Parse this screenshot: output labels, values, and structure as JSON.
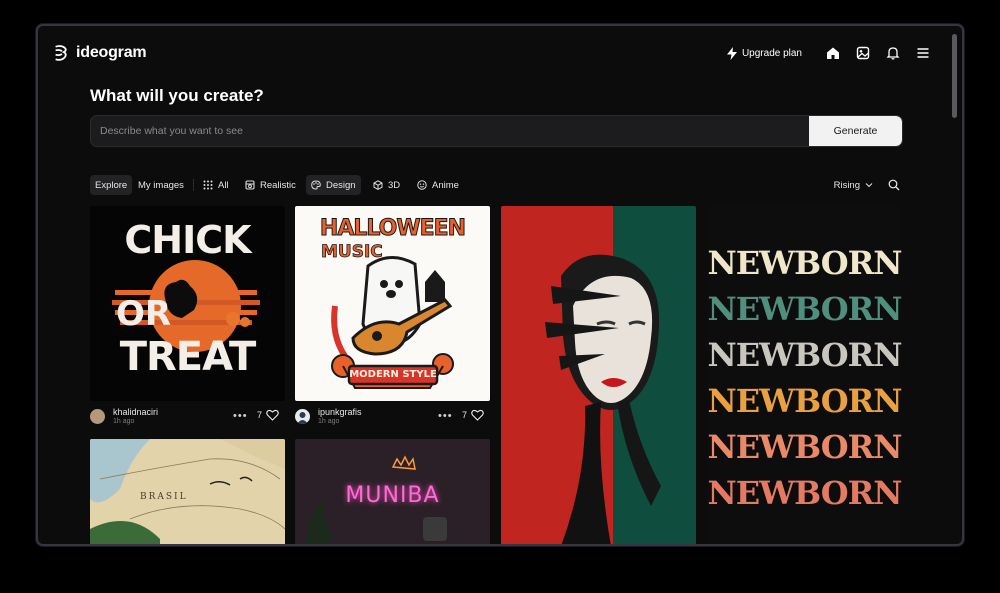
{
  "brand": {
    "name": "ideogram"
  },
  "header": {
    "upgrade_label": "Upgrade plan",
    "icons": [
      "home-icon",
      "gallery-icon",
      "bell-icon",
      "menu-icon"
    ]
  },
  "create": {
    "heading": "What will you create?",
    "placeholder": "Describe what you want to see",
    "generate_label": "Generate"
  },
  "filters": {
    "tabs": [
      {
        "label": "Explore",
        "active": true
      },
      {
        "label": "My images",
        "active": false
      }
    ],
    "categories": [
      {
        "label": "All",
        "icon": "grid-icon",
        "active": false
      },
      {
        "label": "Realistic",
        "icon": "camera-icon",
        "active": false
      },
      {
        "label": "Design",
        "icon": "palette-icon",
        "active": true
      },
      {
        "label": "3D",
        "icon": "cube-icon",
        "active": false
      },
      {
        "label": "Anime",
        "icon": "smiley-icon",
        "active": false
      }
    ],
    "sort_label": "Rising"
  },
  "gallery": [
    {
      "art_text": [
        "CHICK",
        "OR",
        "TREAT"
      ],
      "user": "khalidnaciri",
      "time": "1h ago",
      "likes": "7"
    },
    {
      "art_text": [
        "HALLOWEEN",
        "MUSIC",
        "MODERN STYLE"
      ],
      "user": "ipunkgrafis",
      "time": "1h ago",
      "likes": "7"
    },
    {
      "art_text": []
    },
    {
      "art_text": [
        "NEWBORN",
        "NEWBORN",
        "NEWBORN",
        "NEWBORN",
        "NEWBORN",
        "NEWBORN"
      ]
    },
    {
      "art_text": [
        "BRASIL"
      ]
    },
    {
      "art_text": [
        "MUNIBA"
      ]
    }
  ],
  "colors": {
    "accent_red": "#c0261f",
    "accent_green": "#0f4d3f",
    "halloween_orange": "#e8612b"
  }
}
